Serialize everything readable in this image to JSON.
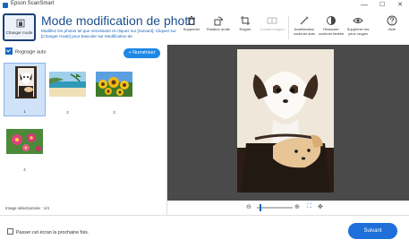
{
  "window": {
    "title": "Epson ScanSmart",
    "minimize": "—",
    "maximize": "☐",
    "close": "✕"
  },
  "toolbar": {
    "change_mode": "Changer mode",
    "heading": "Mode modification de photo",
    "description": "Modifiez les photos tel que nécessaire et cliquez sur [Suivant]. Cliquez sur [Changer mode] pour basculer sur Modification de",
    "tools": [
      {
        "label": "Supprimer"
      },
      {
        "label": "Rotation droite"
      },
      {
        "label": "Rogner"
      },
      {
        "label": "Coudre images"
      },
      {
        "label": "Amélioration couleurs auto"
      },
      {
        "label": "Restaurer couleurs fanées"
      },
      {
        "label": "Supprimer les yeux rouges"
      },
      {
        "label": "Aide"
      }
    ]
  },
  "left": {
    "crop_auto": "Rognage auto",
    "scan_button": "+ Numériser",
    "thumbnails": [
      {
        "num": "1",
        "selected": true
      },
      {
        "num": "2",
        "selected": false
      },
      {
        "num": "3",
        "selected": false
      },
      {
        "num": "4",
        "selected": false
      }
    ],
    "footer": "Image sélectionnée : 1/4"
  },
  "zoom": {
    "minus": "⊖",
    "plus": "⊕",
    "fit": "⛶",
    "expand": "✥"
  },
  "bottom": {
    "skip_label": "Passer cet écran la prochaine fois.",
    "next_button": "Suivant"
  }
}
